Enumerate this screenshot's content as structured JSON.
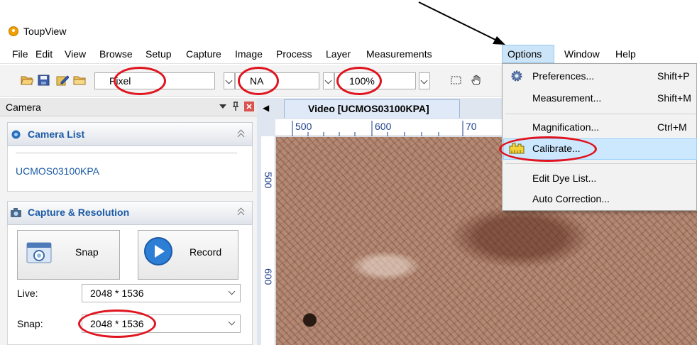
{
  "window": {
    "title": "ToupView",
    "app_icon": "toupview-logo-icon"
  },
  "menubar": {
    "items": [
      "File",
      "Edit",
      "View",
      "Browse",
      "Setup",
      "Capture",
      "Image",
      "Process",
      "Layer",
      "Measurements",
      "Options",
      "Window",
      "Help"
    ],
    "active": "Options"
  },
  "toolbar": {
    "icons": [
      "open-folder-icon",
      "save-icon",
      "edit-icon",
      "folder-icon",
      "rect-select-icon",
      "hand-pan-icon"
    ],
    "unit_combo": "Pixel",
    "magnification_combo": "NA",
    "zoom_combo": "100%"
  },
  "camera_panel": {
    "title": "Camera",
    "camera_list": {
      "title": "Camera List",
      "items": [
        "UCMOS03100KPA"
      ]
    },
    "capture": {
      "title": "Capture & Resolution",
      "snap_label": "Snap",
      "record_label": "Record",
      "live_label": "Live:",
      "live_value": "2048 * 1536",
      "snap_res_label": "Snap:",
      "snap_res_value": "2048 * 1536"
    }
  },
  "document": {
    "tab_title": "Video [UCMOS03100KPA]",
    "ruler_top": [
      "500",
      "600",
      "70"
    ],
    "ruler_left": [
      "500",
      "600"
    ]
  },
  "options_menu": {
    "items": [
      {
        "label": "Preferences...",
        "shortcut": "Shift+P"
      },
      {
        "label": "Measurement...",
        "shortcut": "Shift+M"
      },
      {
        "label": "Magnification...",
        "shortcut": "Ctrl+M"
      },
      {
        "label": "Calibrate...",
        "shortcut": ""
      },
      {
        "label": "Edit Dye List...",
        "shortcut": ""
      },
      {
        "label": "Auto Correction...",
        "shortcut": ""
      }
    ],
    "highlighted": "Calibrate..."
  },
  "annotations": {
    "ring_color": "#e0141e",
    "arrow_color": "#000000"
  }
}
